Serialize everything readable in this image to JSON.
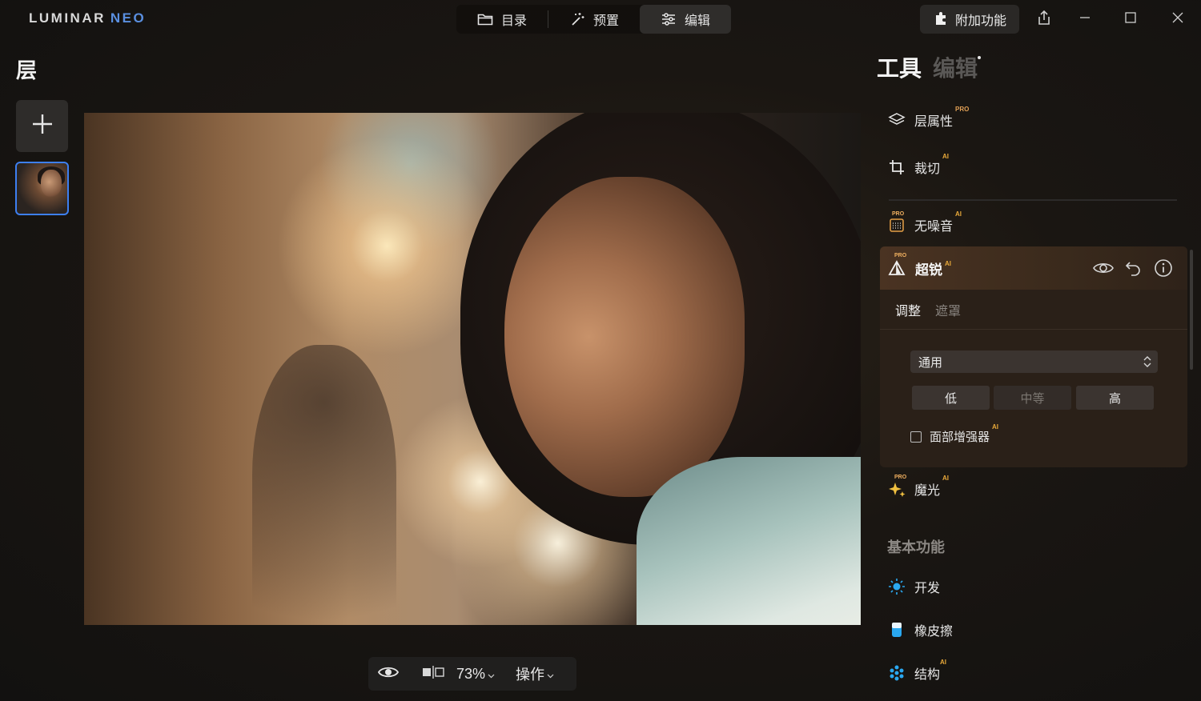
{
  "app": {
    "logo_main": "LUMINAR",
    "logo_neo": "NEO"
  },
  "nav": {
    "catalog": "目录",
    "presets": "预置",
    "edit": "编辑"
  },
  "header": {
    "addons_label": "附加功能"
  },
  "layers": {
    "title": "层"
  },
  "canvas": {
    "zoom": "73%",
    "actions_label": "操作"
  },
  "right_panel": {
    "tab_tools": "工具",
    "tab_edits": "编辑",
    "tools": [
      {
        "label": "层属性",
        "badge": "PRO"
      },
      {
        "label": "裁切",
        "badge": "AI"
      },
      {
        "label": "无噪音",
        "badge": "AI"
      },
      {
        "label": "魔光",
        "badge": "AI"
      }
    ],
    "supersharp": {
      "label": "超锐",
      "badge": "AI",
      "tab_adjust": "调整",
      "tab_mask": "遮罩",
      "mode_value": "通用",
      "levels": [
        "低",
        "中等",
        "高"
      ],
      "face_enhancer_label": "面部增强器",
      "face_enhancer_badge": "AI"
    },
    "section_basic": "基本功能",
    "basic_tools": [
      {
        "label": "开发",
        "badge": ""
      },
      {
        "label": "橡皮擦",
        "badge": ""
      },
      {
        "label": "结构",
        "badge": "AI"
      }
    ],
    "pro_tag": "PRO"
  },
  "colors": {
    "accent_blue": "#3d7ff0",
    "ai_badge": "#e8a93a",
    "panel_header": "#4a3322"
  },
  "icons": {
    "catalog": "folder-icon",
    "presets": "magic-wand-icon",
    "edit": "sliders-icon",
    "addons": "puzzle-icon",
    "share": "share-icon",
    "minimize": "minimize-icon",
    "maximize": "maximize-icon",
    "close": "close-icon"
  }
}
